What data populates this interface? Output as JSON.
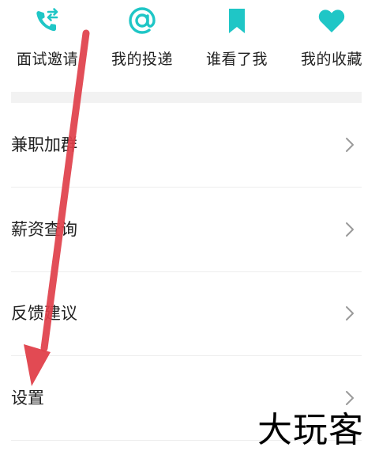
{
  "shortcuts": [
    {
      "label": "面试邀请",
      "icon": "phone-transfer-icon"
    },
    {
      "label": "我的投递",
      "icon": "at-sign-icon"
    },
    {
      "label": "谁看了我",
      "icon": "bookmark-icon"
    },
    {
      "label": "我的收藏",
      "icon": "heart-icon"
    }
  ],
  "menu": [
    {
      "label": "兼职加群",
      "icon": "chevron-right-icon"
    },
    {
      "label": "薪资查询",
      "icon": "chevron-right-icon"
    },
    {
      "label": "反馈建议",
      "icon": "chevron-right-icon"
    },
    {
      "label": "设置",
      "icon": "chevron-right-icon"
    }
  ],
  "colors": {
    "accent": "#1fc6c6",
    "text": "#222222",
    "chevron": "#9a9a9a",
    "annotation": "#e0404a",
    "divider": "#f2f2f2"
  },
  "watermark": {
    "text": "大玩客"
  }
}
